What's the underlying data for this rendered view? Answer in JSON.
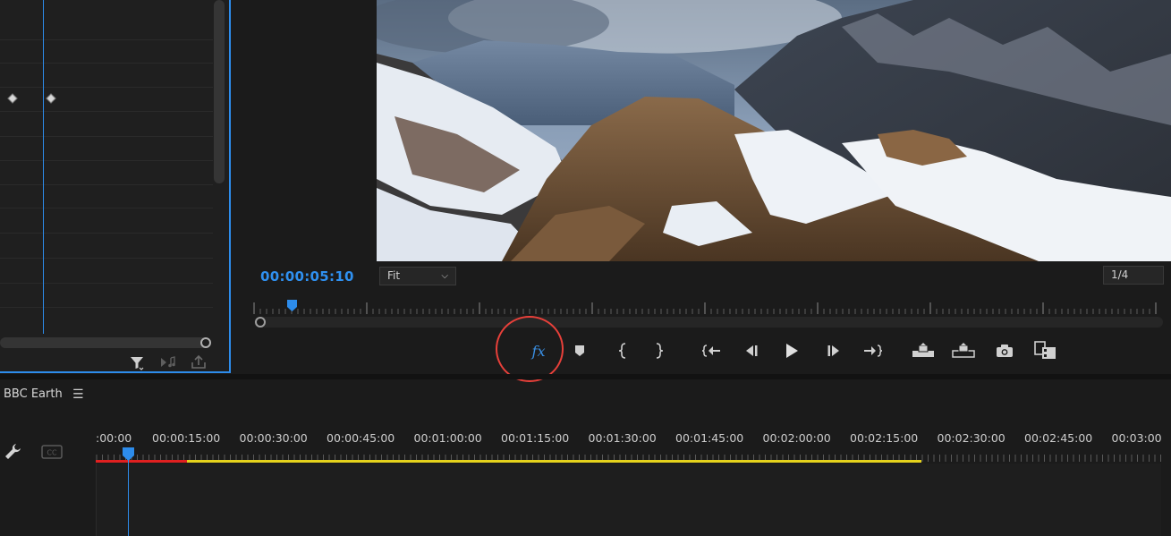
{
  "program_monitor": {
    "timecode": "00:00:05:10",
    "zoom_fit": "Fit",
    "resolution": "1/4"
  },
  "timeline": {
    "sequence_name": "BBC Earth",
    "ruler_labels": [
      ":00:00",
      "00:00:15:00",
      "00:00:30:00",
      "00:00:45:00",
      "00:01:00:00",
      "00:01:15:00",
      "00:01:30:00",
      "00:01:45:00",
      "00:02:00:00",
      "00:02:15:00",
      "00:02:30:00",
      "00:02:45:00",
      "00:03:00"
    ]
  },
  "transport": {
    "fx_label": "fx"
  },
  "colors": {
    "accent": "#2d8ceb",
    "highlight": "#e8403a",
    "render_red": "#e02020",
    "render_yellow": "#e5d21c"
  }
}
